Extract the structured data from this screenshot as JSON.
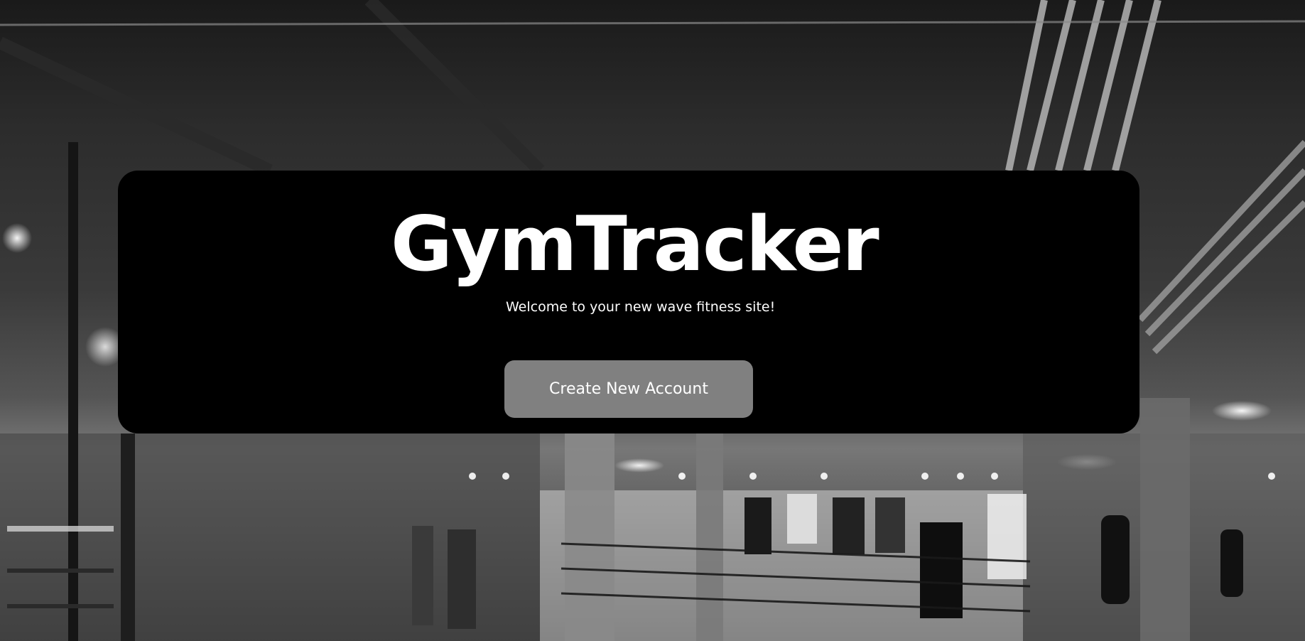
{
  "hero": {
    "title": "GymTracker",
    "subtitle": "Welcome to your new wave fitness site!",
    "cta_label": "Create New Account"
  },
  "colors": {
    "card_background": "#000000",
    "button_background": "#808080",
    "text": "#ffffff"
  },
  "background": {
    "image": "gym-interior-photo"
  }
}
